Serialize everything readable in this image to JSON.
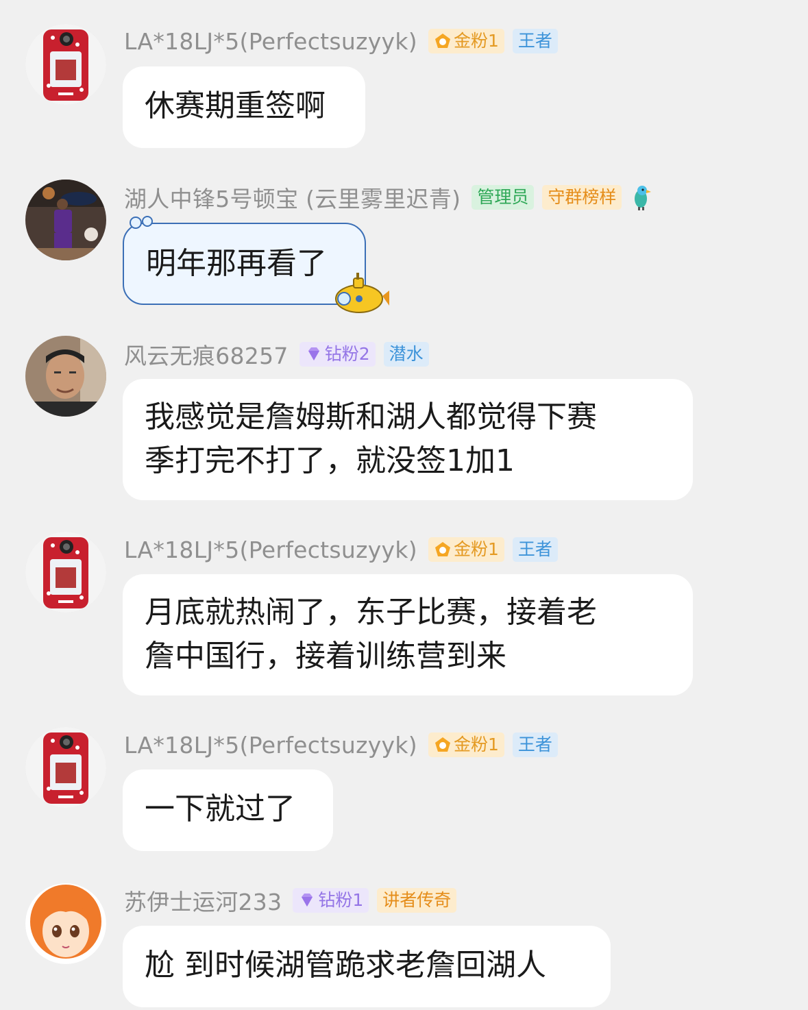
{
  "messages": [
    {
      "avatar": "phone-case-avatar",
      "nickname": "LA*18LJ*5(Perfectsuzyyk)",
      "badges": [
        {
          "kind": "gold",
          "icon": "pentagon-icon",
          "label": "金粉1"
        },
        {
          "kind": "king",
          "label": "王者"
        }
      ],
      "lines": [
        "休赛期重签啊"
      ]
    },
    {
      "avatar": "basketball-player-avatar",
      "nickname": "湖人中锋5号顿宝 (云里雾里迟青)",
      "badges": [
        {
          "kind": "admin",
          "label": "管理员"
        },
        {
          "kind": "model",
          "label": "守群榜样"
        }
      ],
      "extra_icon": "parrot-icon",
      "bubble_style": "submarine",
      "lines": [
        "明年那再看了"
      ]
    },
    {
      "avatar": "man-face-avatar",
      "nickname": "风云无痕68257",
      "badges": [
        {
          "kind": "diamond",
          "icon": "diamond-icon",
          "label": "钻粉2"
        },
        {
          "kind": "dive",
          "label": "潜水"
        }
      ],
      "lines": [
        "我感觉是詹姆斯和湖人都觉得下赛",
        "季打完不打了，就没签1加1"
      ]
    },
    {
      "avatar": "phone-case-avatar",
      "nickname": "LA*18LJ*5(Perfectsuzyyk)",
      "badges": [
        {
          "kind": "gold",
          "icon": "pentagon-icon",
          "label": "金粉1"
        },
        {
          "kind": "king",
          "label": "王者"
        }
      ],
      "lines": [
        "月底就热闹了，东子比赛，接着老",
        "詹中国行，接着训练营到来"
      ]
    },
    {
      "avatar": "phone-case-avatar",
      "nickname": "LA*18LJ*5(Perfectsuzyyk)",
      "badges": [
        {
          "kind": "gold",
          "icon": "pentagon-icon",
          "label": "金粉1"
        },
        {
          "kind": "king",
          "label": "王者"
        }
      ],
      "lines": [
        "一下就过了"
      ]
    },
    {
      "avatar": "anime-girl-avatar",
      "nickname": "苏伊士运河233",
      "badges": [
        {
          "kind": "diamond",
          "icon": "diamond-icon",
          "label": "钻粉1"
        },
        {
          "kind": "legend",
          "label": "讲者传奇"
        }
      ],
      "lines": [
        "尬 到时候湖管跪求老詹回湖人"
      ]
    }
  ]
}
